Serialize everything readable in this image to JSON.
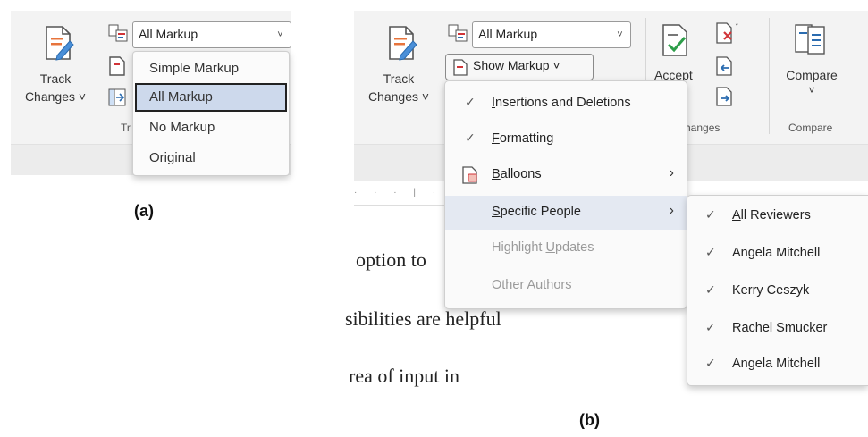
{
  "panel_a": {
    "track_changes": {
      "line1": "Track",
      "line2": "Changes ˅"
    },
    "markup_select": {
      "value": "All Markup",
      "caret": "˅"
    },
    "group_label_partial": "Tr",
    "dropdown": [
      {
        "label": "Simple Markup",
        "selected": false
      },
      {
        "label": "All Markup",
        "selected": true
      },
      {
        "label": "No Markup",
        "selected": false
      },
      {
        "label": "Original",
        "selected": false
      }
    ],
    "caption": "(a)"
  },
  "panel_b": {
    "track_changes": {
      "line1": "Track",
      "line2": "Changes ˅"
    },
    "markup_select": {
      "value": "All Markup",
      "caret": "˅"
    },
    "show_markup_button": "Show Markup ˅",
    "accept_label": "Accept",
    "changes_group_partial": "hanges",
    "compare_button": {
      "label": "Compare",
      "caret": "˅"
    },
    "compare_group": "Compare",
    "show_markup_menu": [
      {
        "label": "Insertions and Deletions",
        "accel": "I",
        "rest": "nsertions and Deletions",
        "checked": true,
        "disabled": false,
        "submenu": false
      },
      {
        "label": "Formatting",
        "accel": "F",
        "rest": "ormatting",
        "checked": true,
        "disabled": false,
        "submenu": false
      },
      {
        "label": "Balloons",
        "accel": "B",
        "rest": "alloons",
        "checked": false,
        "disabled": false,
        "submenu": true,
        "icon": "balloons-icon"
      },
      {
        "label": "Specific People",
        "accel": "S",
        "rest": "pecific People",
        "checked": false,
        "disabled": false,
        "submenu": true,
        "highlighted": true
      },
      {
        "label": "Highlight Updates",
        "pre": "Highlight ",
        "accel": "U",
        "rest": "pdates",
        "checked": false,
        "disabled": true,
        "submenu": false
      },
      {
        "label": "Other Authors",
        "accel": "O",
        "rest": "ther Authors",
        "checked": false,
        "disabled": true,
        "submenu": false
      }
    ],
    "people_menu": [
      {
        "label": "All Reviewers",
        "accel": "A",
        "rest": "ll Reviewers",
        "checked": true
      },
      {
        "label": "Angela Mitchell",
        "checked": true
      },
      {
        "label": "Kerry Ceszyk",
        "checked": true
      },
      {
        "label": "Rachel Smucker",
        "checked": true
      },
      {
        "label": "Angela Mitchell",
        "checked": true
      }
    ],
    "document_lines": [
      "option to",
      "sibilities are helpful",
      "rea of input in"
    ],
    "caption": "(b)"
  },
  "icons": {
    "check": "✓",
    "chevron_right": "›"
  },
  "colors": {
    "selected_bg": "#cdd9ec",
    "hover_bg": "#e4e9f2",
    "accent_red": "#d13438",
    "accent_blue": "#2b6cb0",
    "disabled_text": "#9a9a9a"
  }
}
